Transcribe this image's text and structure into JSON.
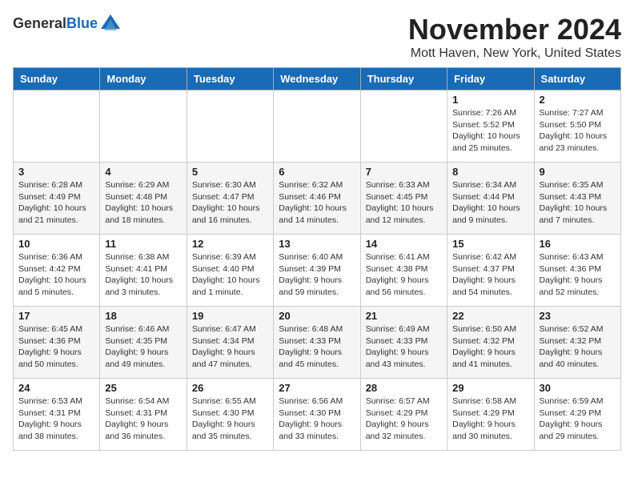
{
  "header": {
    "logo_general": "General",
    "logo_blue": "Blue",
    "month_title": "November 2024",
    "location": "Mott Haven, New York, United States"
  },
  "days_of_week": [
    "Sunday",
    "Monday",
    "Tuesday",
    "Wednesday",
    "Thursday",
    "Friday",
    "Saturday"
  ],
  "weeks": [
    [
      {
        "day": "",
        "info": ""
      },
      {
        "day": "",
        "info": ""
      },
      {
        "day": "",
        "info": ""
      },
      {
        "day": "",
        "info": ""
      },
      {
        "day": "",
        "info": ""
      },
      {
        "day": "1",
        "info": "Sunrise: 7:26 AM\nSunset: 5:52 PM\nDaylight: 10 hours\nand 25 minutes."
      },
      {
        "day": "2",
        "info": "Sunrise: 7:27 AM\nSunset: 5:50 PM\nDaylight: 10 hours\nand 23 minutes."
      }
    ],
    [
      {
        "day": "3",
        "info": "Sunrise: 6:28 AM\nSunset: 4:49 PM\nDaylight: 10 hours\nand 21 minutes."
      },
      {
        "day": "4",
        "info": "Sunrise: 6:29 AM\nSunset: 4:48 PM\nDaylight: 10 hours\nand 18 minutes."
      },
      {
        "day": "5",
        "info": "Sunrise: 6:30 AM\nSunset: 4:47 PM\nDaylight: 10 hours\nand 16 minutes."
      },
      {
        "day": "6",
        "info": "Sunrise: 6:32 AM\nSunset: 4:46 PM\nDaylight: 10 hours\nand 14 minutes."
      },
      {
        "day": "7",
        "info": "Sunrise: 6:33 AM\nSunset: 4:45 PM\nDaylight: 10 hours\nand 12 minutes."
      },
      {
        "day": "8",
        "info": "Sunrise: 6:34 AM\nSunset: 4:44 PM\nDaylight: 10 hours\nand 9 minutes."
      },
      {
        "day": "9",
        "info": "Sunrise: 6:35 AM\nSunset: 4:43 PM\nDaylight: 10 hours\nand 7 minutes."
      }
    ],
    [
      {
        "day": "10",
        "info": "Sunrise: 6:36 AM\nSunset: 4:42 PM\nDaylight: 10 hours\nand 5 minutes."
      },
      {
        "day": "11",
        "info": "Sunrise: 6:38 AM\nSunset: 4:41 PM\nDaylight: 10 hours\nand 3 minutes."
      },
      {
        "day": "12",
        "info": "Sunrise: 6:39 AM\nSunset: 4:40 PM\nDaylight: 10 hours\nand 1 minute."
      },
      {
        "day": "13",
        "info": "Sunrise: 6:40 AM\nSunset: 4:39 PM\nDaylight: 9 hours\nand 59 minutes."
      },
      {
        "day": "14",
        "info": "Sunrise: 6:41 AM\nSunset: 4:38 PM\nDaylight: 9 hours\nand 56 minutes."
      },
      {
        "day": "15",
        "info": "Sunrise: 6:42 AM\nSunset: 4:37 PM\nDaylight: 9 hours\nand 54 minutes."
      },
      {
        "day": "16",
        "info": "Sunrise: 6:43 AM\nSunset: 4:36 PM\nDaylight: 9 hours\nand 52 minutes."
      }
    ],
    [
      {
        "day": "17",
        "info": "Sunrise: 6:45 AM\nSunset: 4:36 PM\nDaylight: 9 hours\nand 50 minutes."
      },
      {
        "day": "18",
        "info": "Sunrise: 6:46 AM\nSunset: 4:35 PM\nDaylight: 9 hours\nand 49 minutes."
      },
      {
        "day": "19",
        "info": "Sunrise: 6:47 AM\nSunset: 4:34 PM\nDaylight: 9 hours\nand 47 minutes."
      },
      {
        "day": "20",
        "info": "Sunrise: 6:48 AM\nSunset: 4:33 PM\nDaylight: 9 hours\nand 45 minutes."
      },
      {
        "day": "21",
        "info": "Sunrise: 6:49 AM\nSunset: 4:33 PM\nDaylight: 9 hours\nand 43 minutes."
      },
      {
        "day": "22",
        "info": "Sunrise: 6:50 AM\nSunset: 4:32 PM\nDaylight: 9 hours\nand 41 minutes."
      },
      {
        "day": "23",
        "info": "Sunrise: 6:52 AM\nSunset: 4:32 PM\nDaylight: 9 hours\nand 40 minutes."
      }
    ],
    [
      {
        "day": "24",
        "info": "Sunrise: 6:53 AM\nSunset: 4:31 PM\nDaylight: 9 hours\nand 38 minutes."
      },
      {
        "day": "25",
        "info": "Sunrise: 6:54 AM\nSunset: 4:31 PM\nDaylight: 9 hours\nand 36 minutes."
      },
      {
        "day": "26",
        "info": "Sunrise: 6:55 AM\nSunset: 4:30 PM\nDaylight: 9 hours\nand 35 minutes."
      },
      {
        "day": "27",
        "info": "Sunrise: 6:56 AM\nSunset: 4:30 PM\nDaylight: 9 hours\nand 33 minutes."
      },
      {
        "day": "28",
        "info": "Sunrise: 6:57 AM\nSunset: 4:29 PM\nDaylight: 9 hours\nand 32 minutes."
      },
      {
        "day": "29",
        "info": "Sunrise: 6:58 AM\nSunset: 4:29 PM\nDaylight: 9 hours\nand 30 minutes."
      },
      {
        "day": "30",
        "info": "Sunrise: 6:59 AM\nSunset: 4:29 PM\nDaylight: 9 hours\nand 29 minutes."
      }
    ]
  ]
}
